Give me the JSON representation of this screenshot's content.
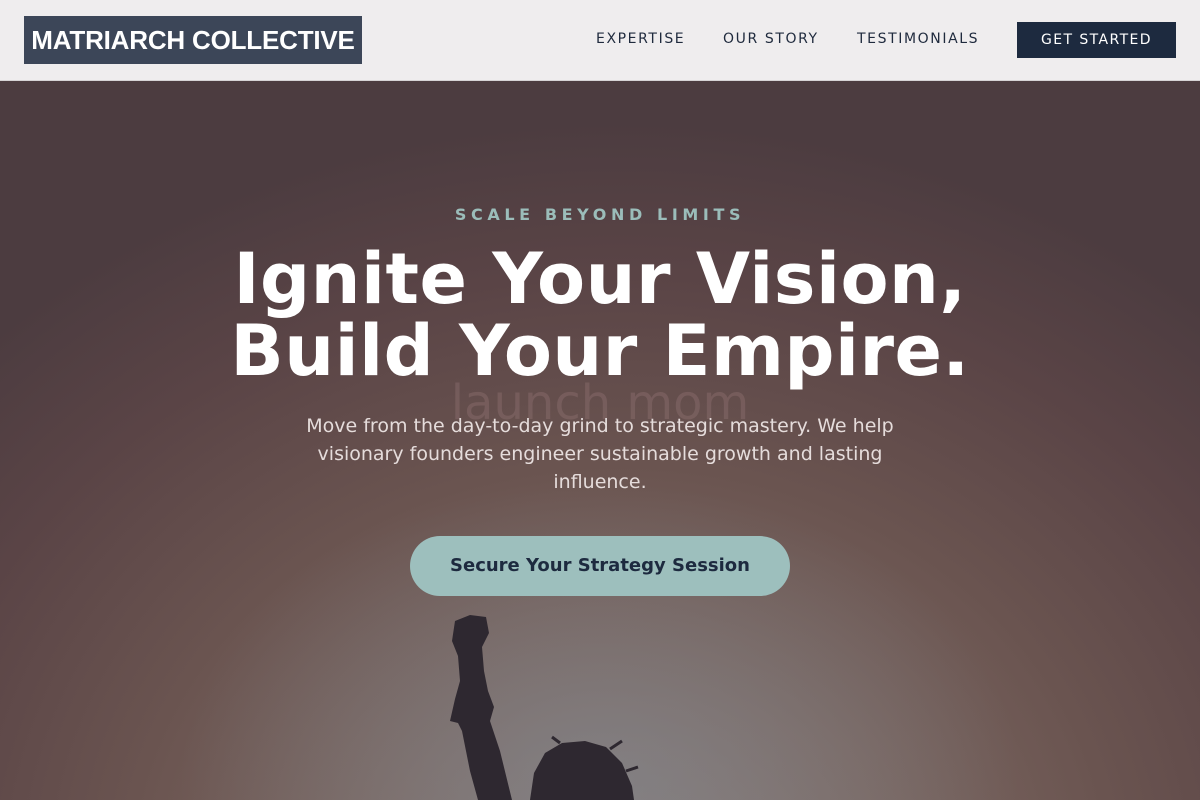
{
  "brand": {
    "name": "MATRIARCH COLLECTIVE",
    "logo_bg": "#3c4658"
  },
  "nav": {
    "links": [
      {
        "label": "EXPERTISE"
      },
      {
        "label": "OUR STORY"
      },
      {
        "label": "TESTIMONIALS"
      }
    ],
    "cta_label": "GET STARTED",
    "cta_color": "#1d2a3f"
  },
  "hero": {
    "eyebrow": "SCALE BEYOND LIMITS",
    "headline_line1": "Ignite Your Vision,",
    "headline_line2": "Build Your Empire.",
    "watermark": "launch mom",
    "subtext": "Move from the day-to-day grind to strategic mastery. We help visionary founders engineer sustainable growth and lasting influence.",
    "cta_label": "Secure Your Strategy Session",
    "accent_color": "#9dbfbd",
    "background_image": "woman-raised-fist-silhouette"
  }
}
